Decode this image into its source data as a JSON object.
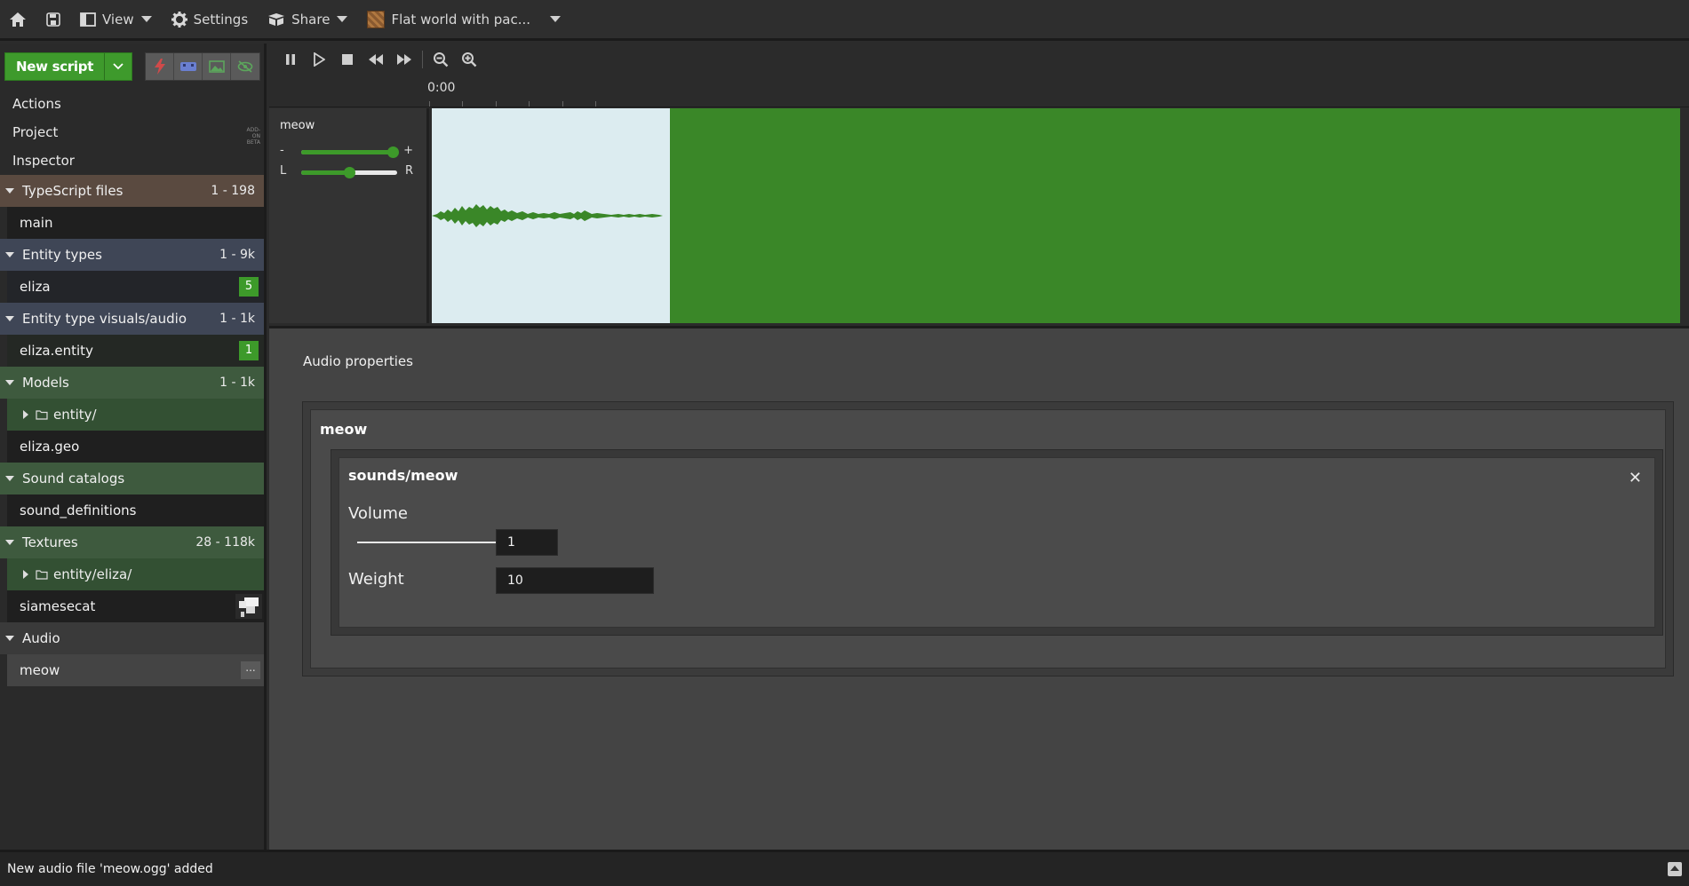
{
  "topbar": {
    "view_label": "View",
    "settings_label": "Settings",
    "share_label": "Share",
    "project_label": "Flat world with pac..."
  },
  "sidebar": {
    "new_script_label": "New script",
    "nav": {
      "actions": "Actions",
      "project": "Project",
      "inspector": "Inspector",
      "addon_tag": "ADD-ON BETA"
    },
    "sections": {
      "typescript": {
        "title": "TypeScript files",
        "range": "1 - 198",
        "items": [
          "main"
        ]
      },
      "entity_types": {
        "title": "Entity types",
        "range": "1 - 9k",
        "item": "eliza",
        "badge": "5"
      },
      "entity_visuals": {
        "title": "Entity type visuals/audio",
        "range": "1 - 1k",
        "item": "eliza.entity",
        "badge": "1"
      },
      "models": {
        "title": "Models",
        "range": "1 - 1k",
        "folder": "entity/",
        "item": "eliza.geo"
      },
      "sound_catalogs": {
        "title": "Sound catalogs",
        "item": "sound_definitions"
      },
      "textures": {
        "title": "Textures",
        "range": "28 - 118k",
        "folder": "entity/eliza/",
        "item": "siamesecat"
      },
      "audio": {
        "title": "Audio",
        "item": "meow",
        "more": "..."
      }
    }
  },
  "timeline": {
    "time_label": "0:00",
    "track": {
      "name": "meow",
      "minus": "-",
      "plus": "+",
      "left": "L",
      "right": "R",
      "volume_level": 0.95,
      "pan_level": 0.5
    }
  },
  "properties": {
    "title": "Audio properties",
    "sound_name": "meow",
    "sound_path": "sounds/meow",
    "volume_label": "Volume",
    "volume_value": "1",
    "weight_label": "Weight",
    "weight_value": "10"
  },
  "status": {
    "message": "New audio file 'meow.ogg' added"
  },
  "colors": {
    "accent_green": "#3d9a2a",
    "clip_bg": "#dcecf0",
    "track_bg": "#3a8728"
  }
}
